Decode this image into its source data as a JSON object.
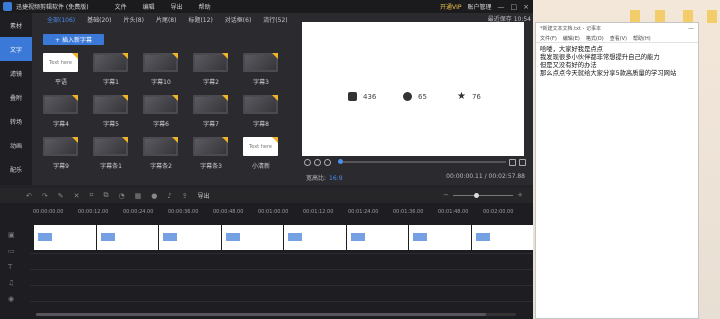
{
  "app": {
    "title": "迅捷视频剪辑软件 (免费版)",
    "menu": [
      "文件",
      "编辑",
      "导出",
      "帮助"
    ],
    "vip_label": "开通VIP",
    "account_label": "账户管理",
    "window_controls": [
      "—",
      "□",
      "×"
    ]
  },
  "sidebar": {
    "items": [
      {
        "label": "素材",
        "active": false
      },
      {
        "label": "文字",
        "active": true
      },
      {
        "label": "滤镜",
        "active": false
      },
      {
        "label": "叠附",
        "active": false
      },
      {
        "label": "转场",
        "active": false
      },
      {
        "label": "动画",
        "active": false
      },
      {
        "label": "配乐",
        "active": false
      }
    ]
  },
  "library": {
    "tabs": [
      "全部(106)",
      "基础(20)",
      "片头(8)",
      "片尾(8)",
      "标题(12)",
      "对话框(6)",
      "流行(52)"
    ],
    "insert_button": "+ 插入新字幕",
    "items": [
      {
        "label": "平语",
        "style": "white",
        "text": "Text here"
      },
      {
        "label": "字幕1",
        "style": "dark"
      },
      {
        "label": "字幕10",
        "style": "dark"
      },
      {
        "label": "字幕2",
        "style": "dark"
      },
      {
        "label": "字幕3",
        "style": "dark"
      },
      {
        "label": "字幕4",
        "style": "dark"
      },
      {
        "label": "字幕5",
        "style": "dark"
      },
      {
        "label": "字幕6",
        "style": "dark"
      },
      {
        "label": "字幕7",
        "style": "dark"
      },
      {
        "label": "字幕8",
        "style": "dark"
      },
      {
        "label": "字幕9",
        "style": "dark"
      },
      {
        "label": "字幕条1",
        "style": "dark"
      },
      {
        "label": "字幕条2",
        "style": "dark"
      },
      {
        "label": "字幕条3",
        "style": "dark"
      },
      {
        "label": "小清新",
        "style": "white",
        "text": "Text here"
      }
    ]
  },
  "preview": {
    "save_text": "最近保存 10:54",
    "stats": [
      {
        "icon": "thumbs-up-icon",
        "value": "436"
      },
      {
        "icon": "coin-icon",
        "value": "65"
      },
      {
        "icon": "star-icon",
        "value": "76"
      }
    ],
    "ratio_label": "宽高比:",
    "ratio_value": "16:9",
    "time_current": "00:00:00.11",
    "time_total": "00:02:57.88",
    "time_sep": " / "
  },
  "toolbar": {
    "export_label": "导出"
  },
  "timeline": {
    "ruler": [
      "00:00:00.00",
      "00:00:12.00",
      "00:00:24.00",
      "00:00:36.00",
      "00:00:48.00",
      "00:01:00.00",
      "00:01:12.00",
      "00:01:24.00",
      "00:01:36.00",
      "00:01:48.00",
      "00:02:00.00"
    ]
  },
  "notepad": {
    "title": "*新建文本文档.txt - 记事本",
    "menu": [
      "文件(F)",
      "编辑(E)",
      "格式(O)",
      "查看(V)",
      "帮助(H)"
    ],
    "lines": [
      "哈喽，大家好我是点点",
      "我发现很多小伙伴都非常想提升自己的能力",
      "但是又没有好的办法",
      "那么点点今天就给大家分享5款高质量的学习网站"
    ]
  },
  "colors": {
    "accent": "#3a79d8",
    "vip": "#f0c24b",
    "corner_badge": "#f0b429"
  }
}
